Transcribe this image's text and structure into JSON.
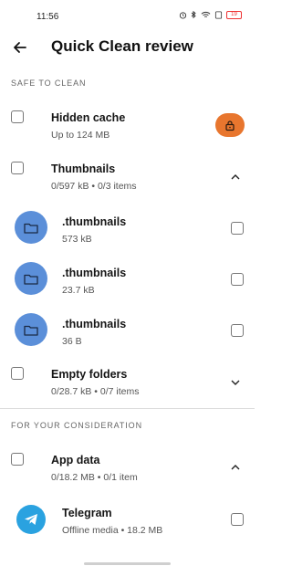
{
  "status": {
    "time": "11:56",
    "battery": "19"
  },
  "header": {
    "title": "Quick Clean review"
  },
  "safe_section": {
    "label": "SAFE TO CLEAN"
  },
  "hidden_cache": {
    "title": "Hidden cache",
    "subtitle": "Up to 124 MB"
  },
  "thumbnails": {
    "title": "Thumbnails",
    "subtitle": "0/597 kB • 0/3 items",
    "items": [
      {
        "name": ".thumbnails",
        "size": "573 kB"
      },
      {
        "name": ".thumbnails",
        "size": "23.7 kB"
      },
      {
        "name": ".thumbnails",
        "size": "36 B"
      }
    ]
  },
  "empty_folders": {
    "title": "Empty folders",
    "subtitle": "0/28.7 kB • 0/7 items"
  },
  "consideration_section": {
    "label": "FOR YOUR CONSIDERATION"
  },
  "app_data": {
    "title": "App data",
    "subtitle": "0/18.2 MB • 0/1 item",
    "items": [
      {
        "name": "Telegram",
        "detail": "Offline media • 18.2 MB"
      }
    ]
  },
  "colors": {
    "accent_orange": "#e8762e",
    "folder_blue": "#5b8fd9",
    "telegram_blue": "#2aa2e0"
  }
}
